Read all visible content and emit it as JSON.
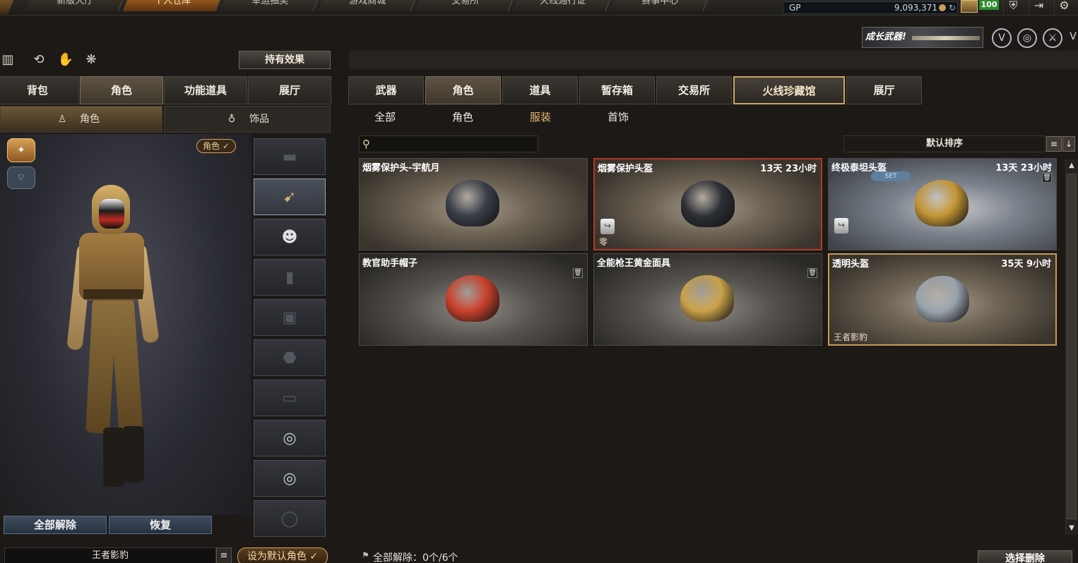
{
  "top_nav": {
    "tabs": [
      {
        "label": "新版大厅",
        "active": false
      },
      {
        "label": "个人仓库",
        "active": true
      },
      {
        "label": "幸运抽奖",
        "active": false
      },
      {
        "label": "游戏商城",
        "active": false
      },
      {
        "label": "交易所",
        "active": false
      },
      {
        "label": "火线通行证",
        "active": false
      },
      {
        "label": "赛事中心",
        "active": false
      }
    ],
    "currency_label": "GP",
    "currency_value": "9,093,371",
    "level": "100"
  },
  "promo": {
    "banner_text": "成长武器!",
    "icons": [
      "shield-v-icon",
      "globe-target-icon",
      "helmet-icon",
      "v-logo-icon"
    ]
  },
  "left_panel": {
    "effect_button": "持有效果",
    "tabs": [
      {
        "label": "背包",
        "active": false
      },
      {
        "label": "角色",
        "active": true
      },
      {
        "label": "功能道具",
        "active": false
      },
      {
        "label": "展厅",
        "active": false
      }
    ],
    "subtabs": [
      {
        "label": "角色",
        "icon": "character-icon",
        "active": true
      },
      {
        "label": "饰品",
        "icon": "ring-icon",
        "active": false
      }
    ],
    "role_chip": "角色 ✓",
    "slots": [
      {
        "icon": "tank-icon",
        "selected": false
      },
      {
        "icon": "arrow-icon",
        "selected": true
      },
      {
        "icon": "mask-icon",
        "selected": false
      },
      {
        "icon": "radio-icon",
        "selected": false
      },
      {
        "icon": "vest-icon",
        "selected": false
      },
      {
        "icon": "armor-icon",
        "selected": false
      },
      {
        "icon": "pants-icon",
        "selected": false
      },
      {
        "icon": "ring-icon",
        "selected": false
      },
      {
        "icon": "ring-icon",
        "selected": false
      },
      {
        "icon": "bracelet-icon",
        "selected": false
      }
    ],
    "unequip_all_button": "全部解除",
    "restore_button": "恢复",
    "outfit_name": "王者影豹",
    "set_default_button": "设为默认角色 ✓"
  },
  "right_panel": {
    "tabs": [
      {
        "label": "武器",
        "active": false,
        "special": false
      },
      {
        "label": "角色",
        "active": true,
        "special": false
      },
      {
        "label": "道具",
        "active": false,
        "special": false
      },
      {
        "label": "暂存箱",
        "active": false,
        "special": false
      },
      {
        "label": "交易所",
        "active": false,
        "special": false
      },
      {
        "label": "火线珍藏馆",
        "active": false,
        "special": true
      },
      {
        "label": "展厅",
        "active": false,
        "special": false
      }
    ],
    "categories": [
      {
        "label": "全部",
        "active": false
      },
      {
        "label": "角色",
        "active": false
      },
      {
        "label": "服装",
        "active": true
      },
      {
        "label": "首饰",
        "active": false
      }
    ],
    "search_placeholder": "",
    "sort_label": "默认排序",
    "items": [
      {
        "name": "烟雾保护头-宇航月",
        "time": "",
        "footer": "",
        "share": false,
        "trash": false,
        "set": false,
        "style": "warm",
        "border": "none",
        "item_color": "#3a3f48"
      },
      {
        "name": "烟雾保护头盔",
        "time": "13天 23小时",
        "footer": "零",
        "share": true,
        "trash": false,
        "set": false,
        "style": "warm",
        "border": "red",
        "item_color": "#2c2f36"
      },
      {
        "name": "终极泰坦头盔",
        "time": "13天 23小时",
        "footer": "",
        "share": true,
        "trash": true,
        "set": true,
        "set_label": "SET",
        "style": "cool",
        "border": "none",
        "item_color": "#c49535"
      },
      {
        "name": "教官助手帽子",
        "time": "",
        "footer": "",
        "share": false,
        "trash": true,
        "set": false,
        "style": "dark",
        "border": "none",
        "item_color": "#c9412a"
      },
      {
        "name": "全能枪王黄金面具",
        "time": "",
        "footer": "",
        "share": false,
        "trash": true,
        "set": false,
        "style": "dark",
        "border": "none",
        "item_color": "#c9a24a"
      },
      {
        "name": "透明头盔",
        "time": "35天 9小时",
        "footer": "王者影豹",
        "share": false,
        "trash": false,
        "set": false,
        "style": "warm",
        "border": "gold",
        "item_color": "#9aa4ad"
      }
    ],
    "unequip_status": "全部解除：0个/6个",
    "select_delete_button": "选择删除"
  }
}
